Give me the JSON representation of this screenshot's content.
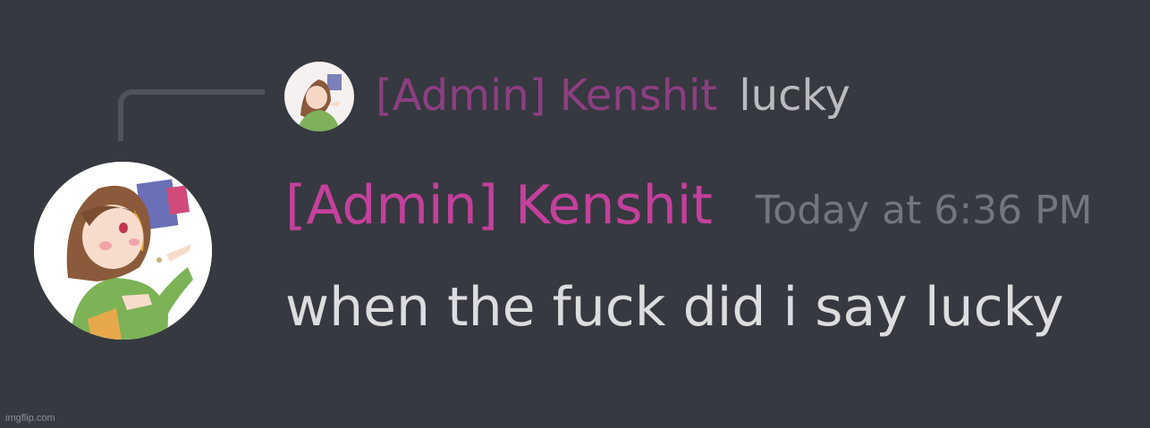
{
  "reply": {
    "author": "[Admin] Kenshit",
    "text": "lucky"
  },
  "message": {
    "author": "[Admin] Kenshit",
    "timestamp": "Today at 6:36 PM",
    "content": "when the fuck did i say lucky"
  },
  "colors": {
    "background": "#36393f",
    "reply_author": "#8d3e82",
    "author": "#c4409d",
    "message_text": "#dcddde",
    "timestamp": "#72767d"
  },
  "icons": {
    "avatar": "anime-character-avatar",
    "reply_avatar": "anime-character-avatar-small"
  },
  "watermark": "imgflip.com"
}
